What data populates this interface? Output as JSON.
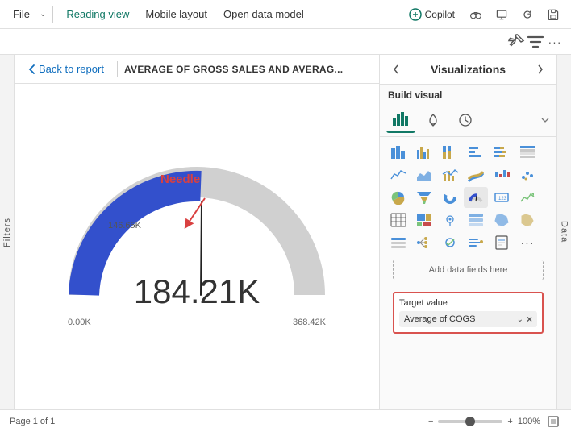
{
  "menubar": {
    "file_label": "File",
    "reading_view_label": "Reading view",
    "mobile_layout_label": "Mobile layout",
    "open_data_model_label": "Open data model",
    "copilot_label": "Copilot"
  },
  "toolbar": {
    "pin_icon": "📌",
    "filter_icon": "≡",
    "more_icon": "···"
  },
  "tab": {
    "back_label": "Back to report",
    "title": "AVERAGE OF GROSS SALES AND AVERAG..."
  },
  "filters": {
    "label": "Filters"
  },
  "chart": {
    "value": "184.21K",
    "marker_value": "146.65K",
    "min": "0.00K",
    "max": "368.42K",
    "needle_label": "Needle"
  },
  "right_panel": {
    "title": "Visualizations",
    "build_visual_label": "Build visual",
    "add_data_label": "Add data fields here",
    "target_label": "Target value",
    "target_chip_label": "Average of COGS"
  },
  "data_tab": {
    "label": "Data"
  },
  "status": {
    "page_label": "Page 1 of 1",
    "zoom_label": "100%"
  }
}
